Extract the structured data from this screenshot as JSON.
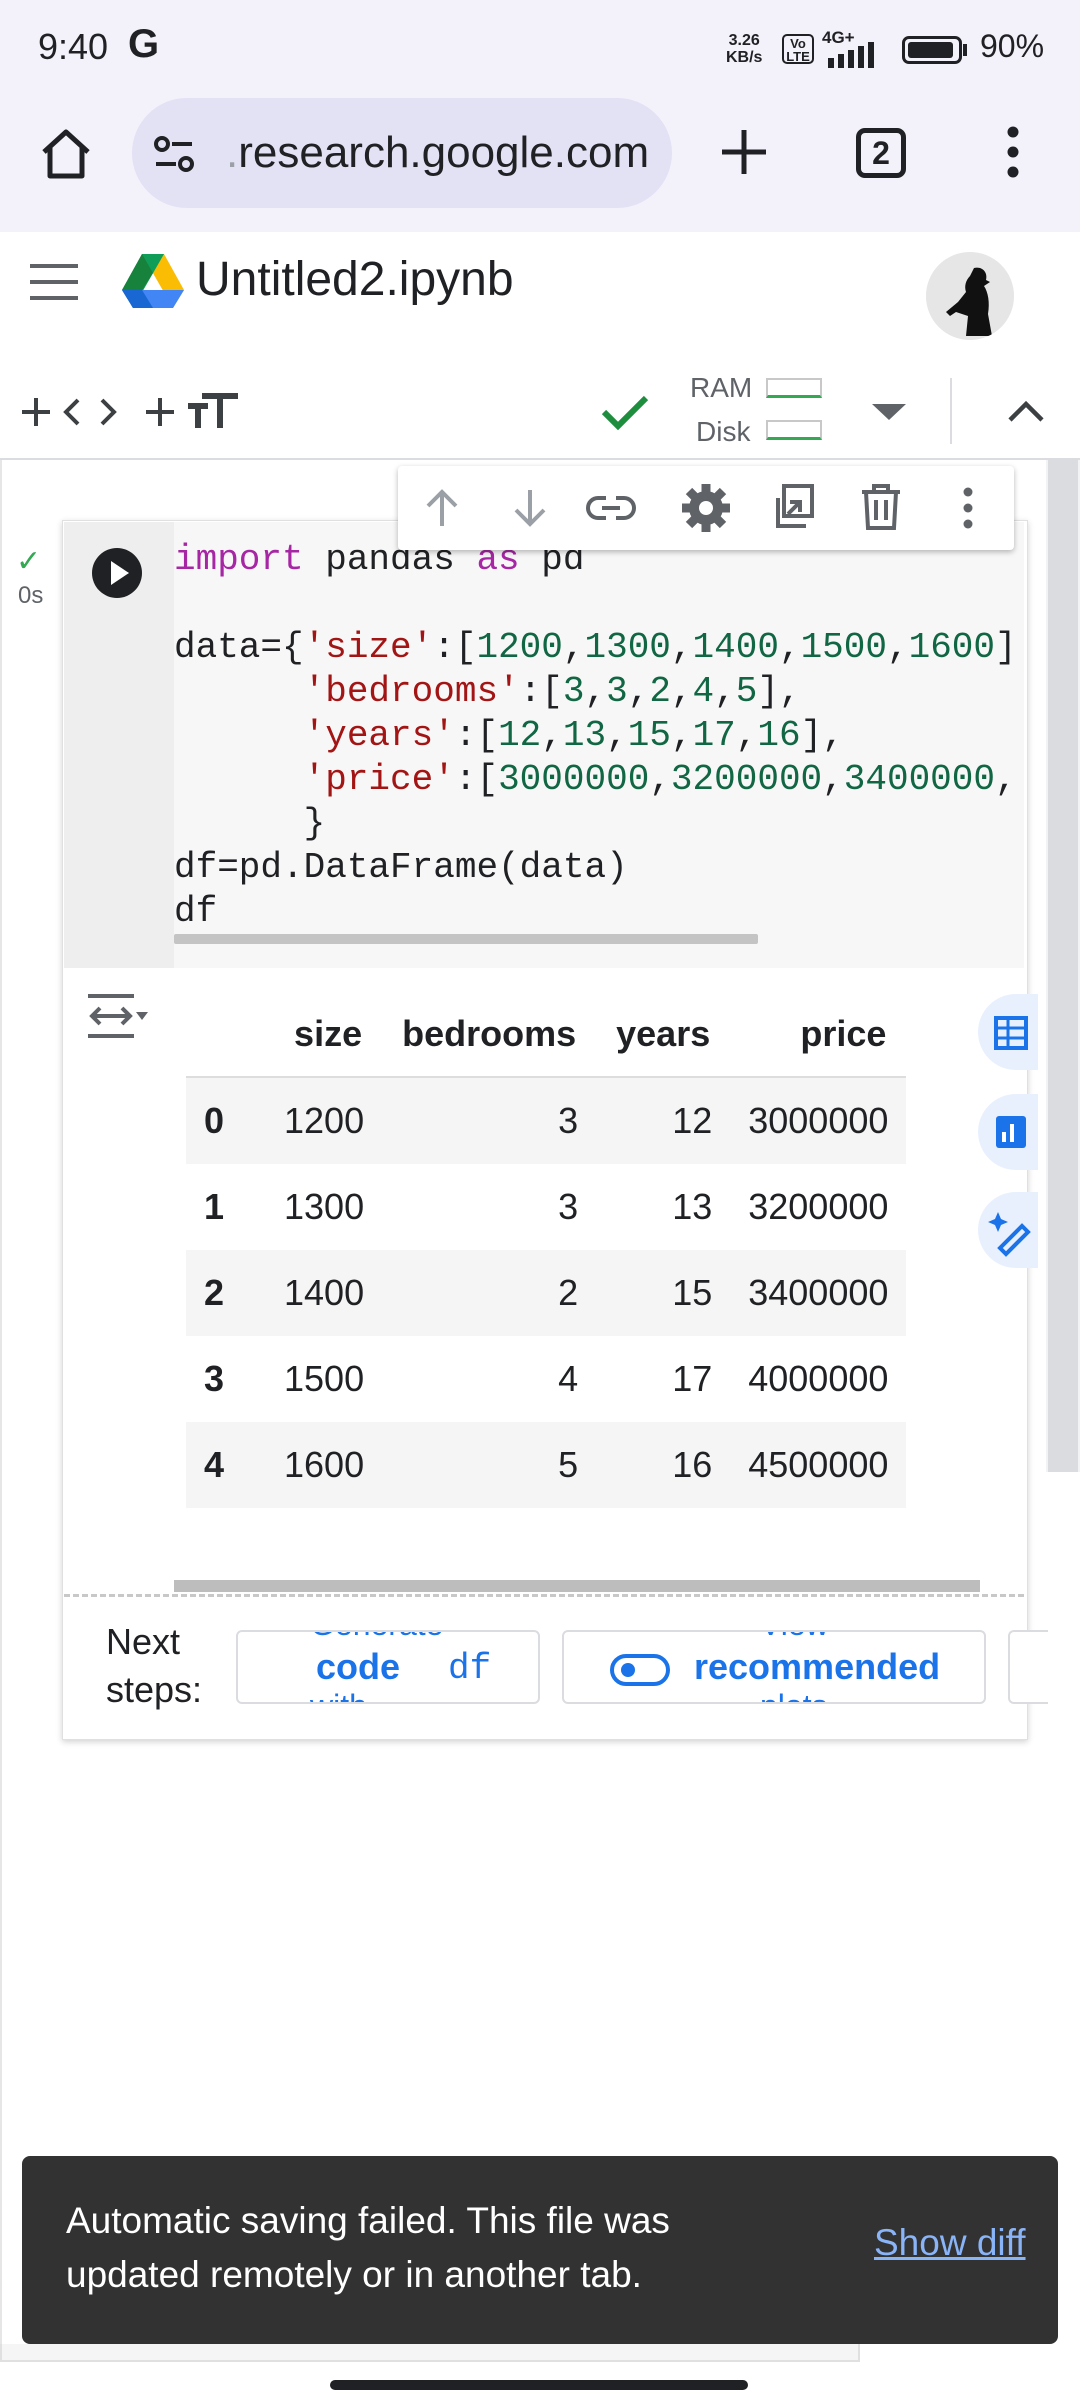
{
  "status_bar": {
    "time": "9:40",
    "g_icon": "G",
    "net_speed_value": "3.26",
    "net_speed_unit": "KB/s",
    "volte_top": "Vo",
    "volte_bottom": "LTE",
    "network": "4G+",
    "battery_percent": "90%",
    "battery_level": 0.9
  },
  "browser": {
    "url_faded": ".",
    "url": "research.google.com",
    "tab_count": "2"
  },
  "colab": {
    "notebook_title": "Untitled2.ipynb",
    "ram_label": "RAM",
    "disk_label": "Disk"
  },
  "cell": {
    "exec_time": "0s",
    "code_lines": [
      "import pandas as pd",
      "",
      "data={'size':[1200,1300,1400,1500,1600]",
      "      'bedrooms':[3,3,2,4,5],",
      "      'years':[12,13,15,17,16],",
      "      'price':[3000000,3200000,3400000,",
      "      }",
      "df=pd.DataFrame(data)",
      "df"
    ]
  },
  "output": {
    "columns": [
      "size",
      "bedrooms",
      "years",
      "price"
    ],
    "rows": [
      {
        "index": "0",
        "size": "1200",
        "bedrooms": "3",
        "years": "12",
        "price": "3000000"
      },
      {
        "index": "1",
        "size": "1300",
        "bedrooms": "3",
        "years": "13",
        "price": "3200000"
      },
      {
        "index": "2",
        "size": "1400",
        "bedrooms": "2",
        "years": "15",
        "price": "3400000"
      },
      {
        "index": "3",
        "size": "1500",
        "bedrooms": "4",
        "years": "17",
        "price": "4000000"
      },
      {
        "index": "4",
        "size": "1600",
        "bedrooms": "5",
        "years": "16",
        "price": "4500000"
      }
    ]
  },
  "next_steps": {
    "label_line1": "Next",
    "label_line2": "steps:",
    "chip1_top": "Generate",
    "chip1_main": "code",
    "chip1_var": "df",
    "chip1_bottom": "with",
    "chip2_top": "View",
    "chip2_main": "recommended",
    "chip2_bottom": "plots"
  },
  "snackbar": {
    "message": "Automatic saving failed. This file was updated remotely or in another tab.",
    "action": "Show diff"
  },
  "colors": {
    "accent_blue": "#1a73e8",
    "check_green": "#34a853",
    "snackbar_bg": "#323232"
  },
  "icons": [
    "home-icon",
    "site-settings-icon",
    "new-tab-icon",
    "tab-switcher-icon",
    "more-vert-icon",
    "menu-icon",
    "drive-logo-icon",
    "add-code-icon",
    "add-text-icon",
    "connected-check-icon",
    "dropdown-icon",
    "collapse-icon",
    "move-up-icon",
    "move-down-icon",
    "link-icon",
    "settings-icon",
    "mirror-cell-icon",
    "delete-icon",
    "run-icon",
    "output-toggle-icon",
    "table-view-icon",
    "chart-icon",
    "magic-icon",
    "toggle-icon"
  ]
}
